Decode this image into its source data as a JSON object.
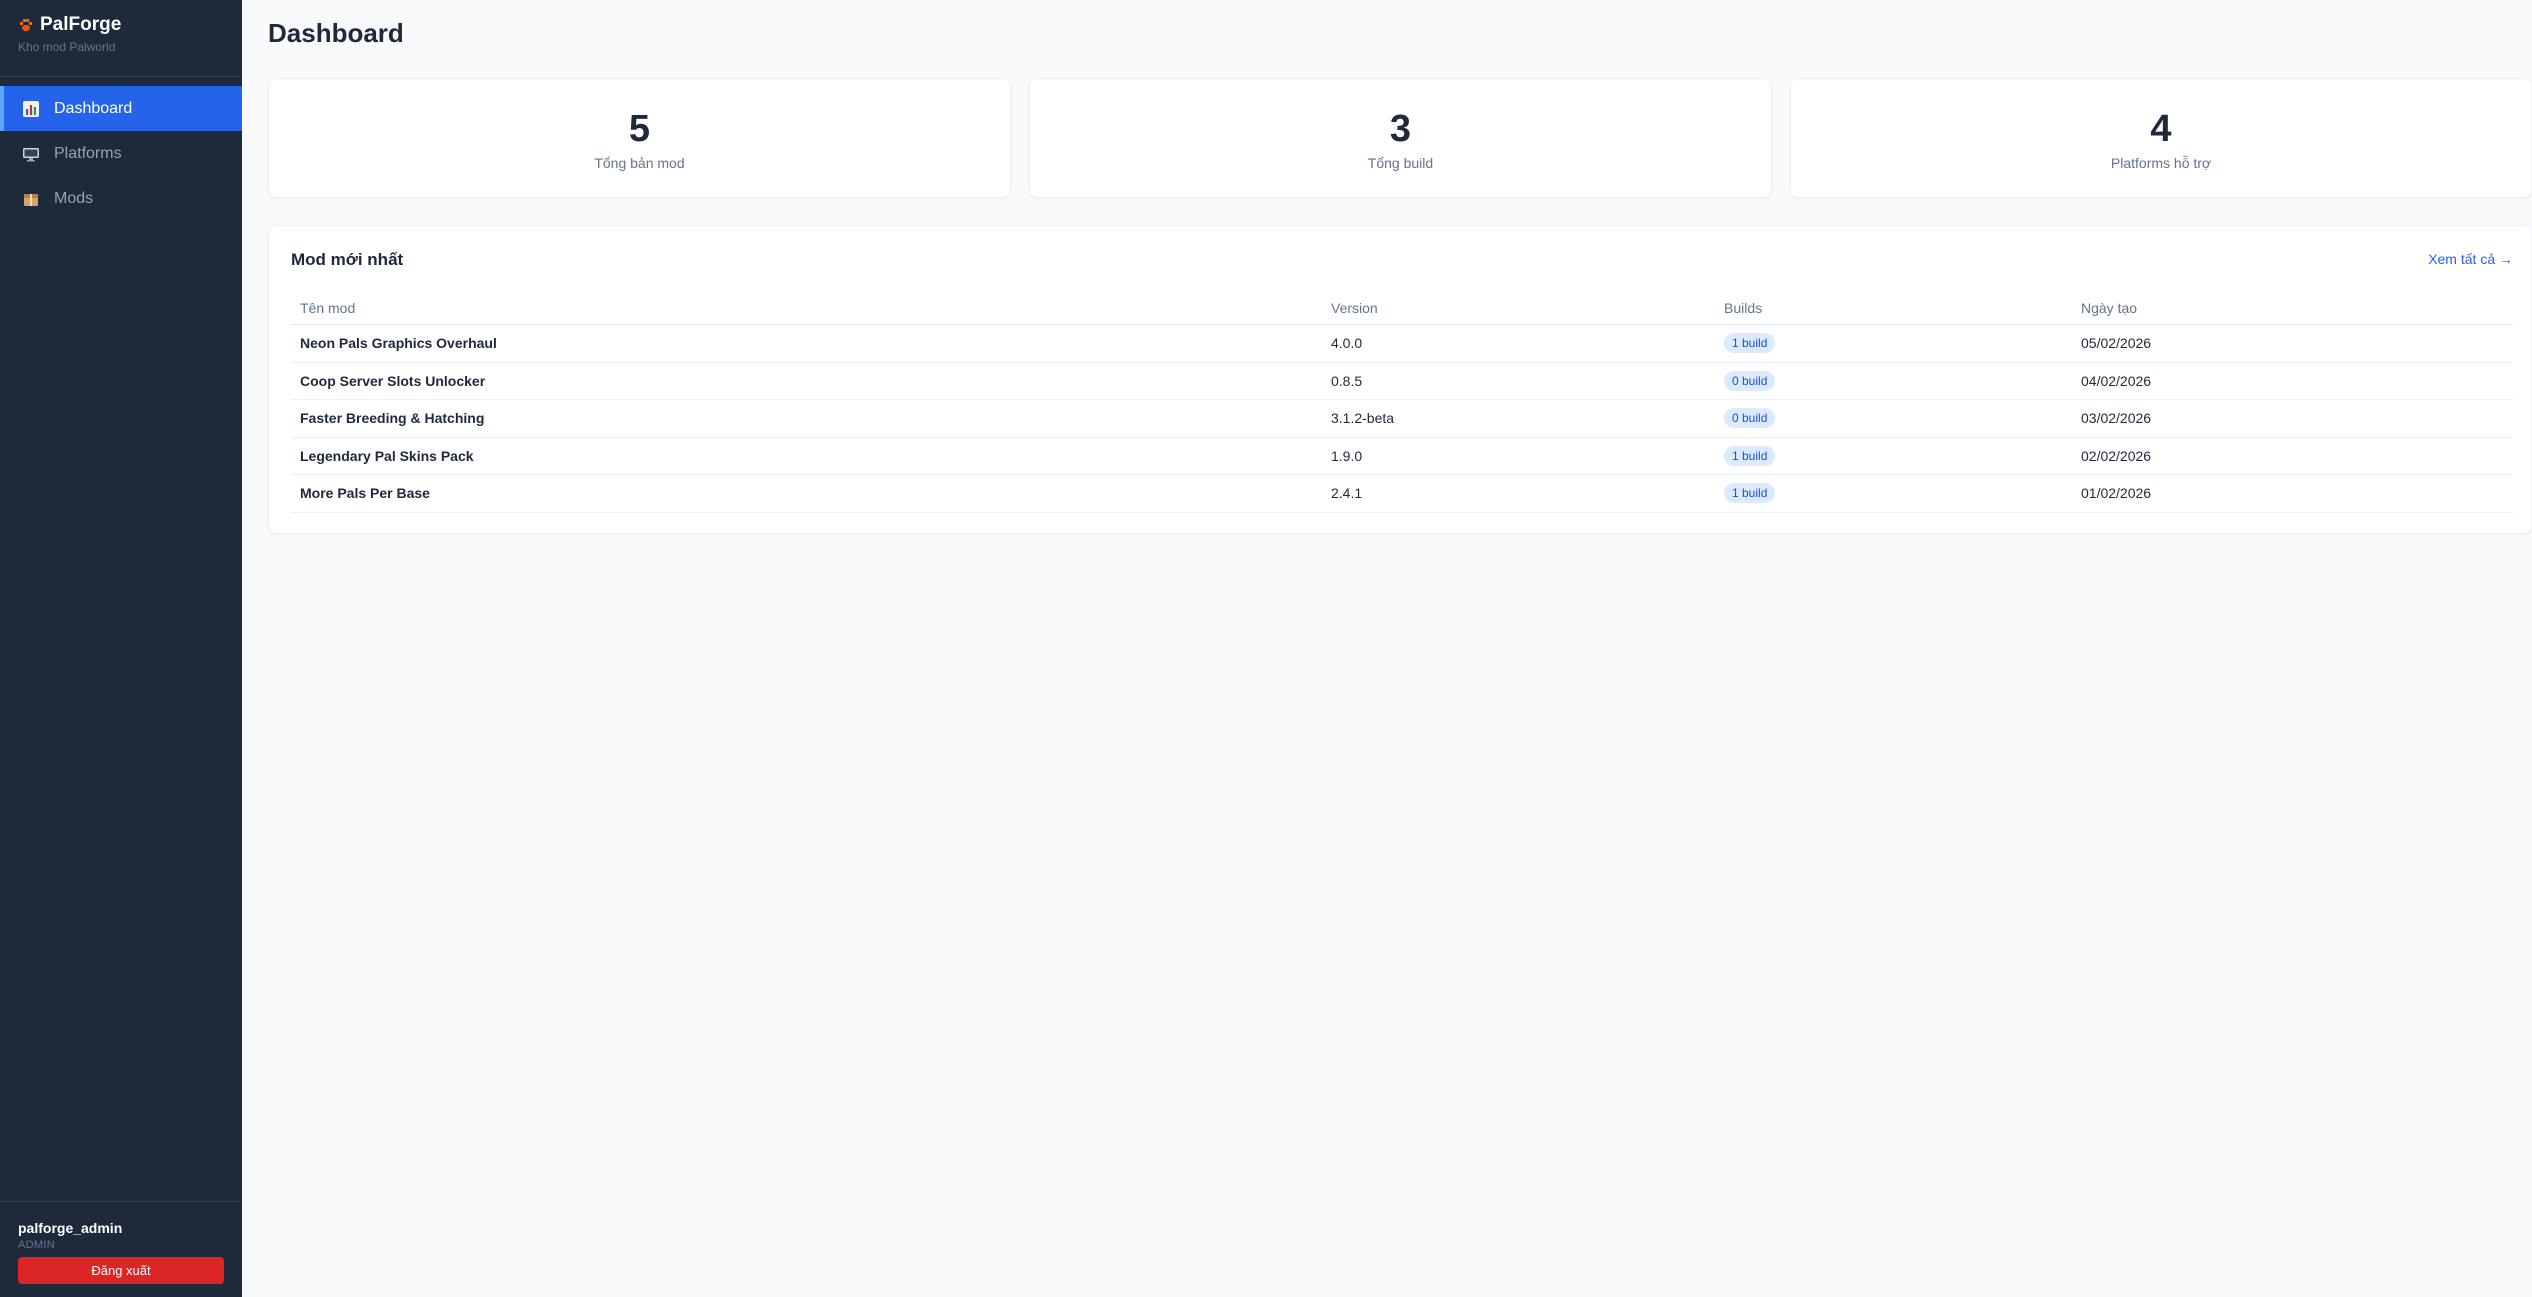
{
  "brand": {
    "title": "PalForge",
    "subtitle": "Kho mod Palworld",
    "logo_icon": "paw-icon"
  },
  "sidebar": {
    "items": [
      {
        "label": "Dashboard",
        "icon": "bar-chart-icon",
        "active": true
      },
      {
        "label": "Platforms",
        "icon": "monitor-icon",
        "active": false
      },
      {
        "label": "Mods",
        "icon": "package-icon",
        "active": false
      }
    ]
  },
  "user": {
    "name": "palforge_admin",
    "role": "ADMIN",
    "logout_label": "Đăng xuất"
  },
  "page": {
    "title": "Dashboard"
  },
  "stats": [
    {
      "value": "5",
      "label": "Tổng bản mod"
    },
    {
      "value": "3",
      "label": "Tổng build"
    },
    {
      "value": "4",
      "label": "Platforms hỗ trợ"
    }
  ],
  "latest": {
    "title": "Mod mới nhất",
    "view_all": "Xem tất cả →",
    "columns": [
      "Tên mod",
      "Version",
      "Builds",
      "Ngày tạo"
    ],
    "rows": [
      {
        "name": "Neon Pals Graphics Overhaul",
        "version": "4.0.0",
        "builds": "1 build",
        "date": "05/02/2026"
      },
      {
        "name": "Coop Server Slots Unlocker",
        "version": "0.8.5",
        "builds": "0 build",
        "date": "04/02/2026"
      },
      {
        "name": "Faster Breeding & Hatching",
        "version": "3.1.2-beta",
        "builds": "0 build",
        "date": "03/02/2026"
      },
      {
        "name": "Legendary Pal Skins Pack",
        "version": "1.9.0",
        "builds": "1 build",
        "date": "02/02/2026"
      },
      {
        "name": "More Pals Per Base",
        "version": "2.4.1",
        "builds": "1 build",
        "date": "01/02/2026"
      }
    ]
  },
  "colors": {
    "sidebar_bg": "#1e293b",
    "accent": "#2563eb",
    "danger": "#dc2626",
    "badge_bg": "#dbeafe"
  }
}
